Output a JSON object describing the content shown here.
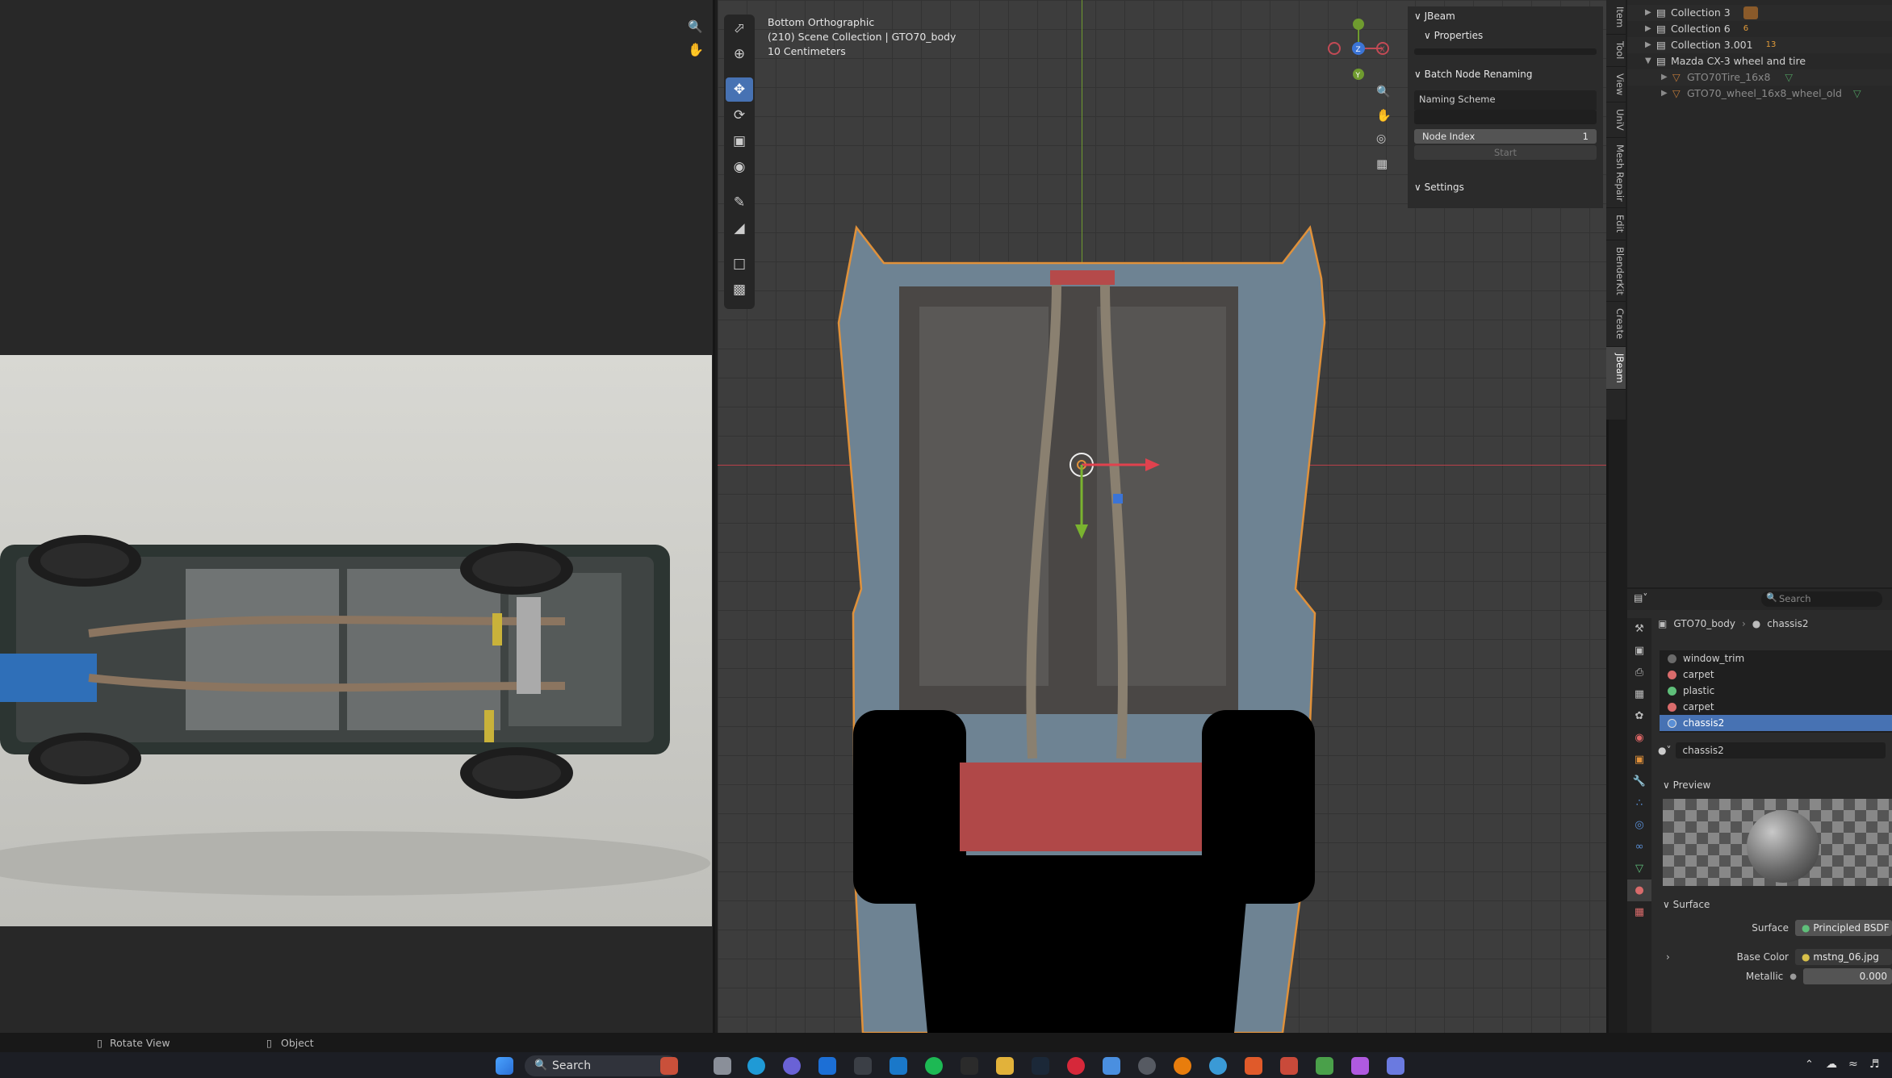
{
  "viewport": {
    "view_name": "Bottom Orthographic",
    "scene_line": "(210) Scene Collection | GTO70_body",
    "scale": "10 Centimeters",
    "gizmo": {
      "z": "Z",
      "y": "Y",
      "x": "X"
    }
  },
  "npanel": {
    "title": "JBeam",
    "properties": "Properties",
    "batch_title": "Batch Node Renaming",
    "naming_scheme": "Naming Scheme",
    "node_index_label": "Node Index",
    "node_index_value": "1",
    "start": "Start",
    "settings": "Settings"
  },
  "side_tabs": [
    "Item",
    "Tool",
    "View",
    "UniV",
    "Mesh Repair",
    "Edit",
    "BlenderKit",
    "Create",
    "JBeam"
  ],
  "outliner": {
    "rows": [
      {
        "label": "Collection 3",
        "badge": ""
      },
      {
        "label": "Collection 6",
        "badge": "6"
      },
      {
        "label": "Collection 3.001",
        "badge": "13"
      },
      {
        "label": "Mazda CX-3 wheel and tire",
        "badge": ""
      },
      {
        "label": "GTO70Tire_16x8",
        "badge": ""
      },
      {
        "label": "GTO70_wheel_16x8_wheel_old",
        "badge": ""
      }
    ]
  },
  "properties": {
    "search_placeholder": "Search",
    "breadcrumb_object": "GTO70_body",
    "breadcrumb_material": "chassis2",
    "materials": [
      {
        "name": "window_trim",
        "color": "#6a6a6a"
      },
      {
        "name": "carpet",
        "color": "#d96b6b"
      },
      {
        "name": "plastic",
        "color": "#5fbf7a"
      },
      {
        "name": "carpet",
        "color": "#d96b6b"
      },
      {
        "name": "chassis2",
        "color": "#5a8fd6"
      }
    ],
    "material_name": "chassis2",
    "preview_label": "Preview",
    "surface_section": "Surface",
    "surface_label": "Surface",
    "surface_value": "Principled BSDF",
    "base_color_label": "Base Color",
    "base_color_value": "mstng_06.jpg",
    "metallic_label": "Metallic",
    "metallic_value": "0.000"
  },
  "statusbar": {
    "rotate_view": "Rotate View",
    "object": "Object"
  },
  "taskbar": {
    "search_label": "Search"
  }
}
